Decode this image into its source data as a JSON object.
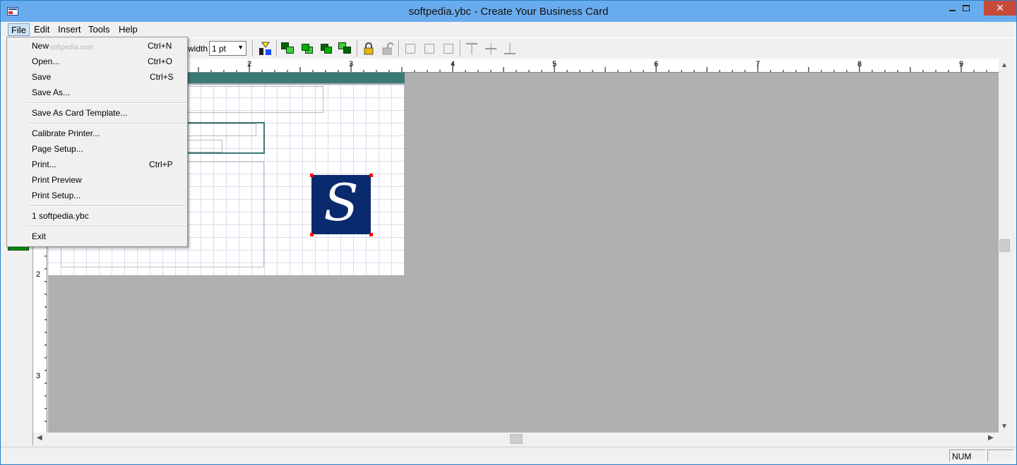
{
  "window": {
    "title": "softpedia.ybc - Create Your Business Card",
    "close_glyph": "✕"
  },
  "menubar": {
    "items": [
      {
        "label": "File"
      },
      {
        "label": "Edit"
      },
      {
        "label": "Insert"
      },
      {
        "label": "Tools"
      },
      {
        "label": "Help"
      }
    ]
  },
  "toolbar": {
    "width_label": "width",
    "width_value": "1 pt",
    "dropdown_glyph": "▼"
  },
  "ruler_top": {
    "numbers": [
      "2",
      "3",
      "4",
      "5",
      "6",
      "7",
      "8",
      "9"
    ]
  },
  "ruler_left": {
    "numbers": [
      "2",
      "3"
    ]
  },
  "logo": {
    "letter": "S",
    "background": "#0a2a6e"
  },
  "file_menu": {
    "watermark": "softpedia.com",
    "items": [
      {
        "label": "New",
        "shortcut": "Ctrl+N"
      },
      {
        "label": "Open...",
        "shortcut": "Ctrl+O"
      },
      {
        "label": "Save",
        "shortcut": "Ctrl+S"
      },
      {
        "label": "Save As...",
        "shortcut": ""
      },
      {
        "label": "Save As Card Template...",
        "shortcut": ""
      },
      {
        "label": "Calibrate Printer...",
        "shortcut": ""
      },
      {
        "label": "Page Setup...",
        "shortcut": ""
      },
      {
        "label": "Print...",
        "shortcut": "Ctrl+P"
      },
      {
        "label": "Print Preview",
        "shortcut": ""
      },
      {
        "label": "Print Setup...",
        "shortcut": ""
      },
      {
        "label": "1 softpedia.ybc",
        "shortcut": ""
      },
      {
        "label": "Exit",
        "shortcut": ""
      }
    ]
  },
  "scroll": {
    "up": "▲",
    "down": "▼",
    "left": "◀",
    "right": "▶"
  },
  "statusbar": {
    "num": "NUM"
  },
  "colors": {
    "titlebar": "#69acee",
    "accent_teal": "#3a7a76",
    "close_red": "#c74a3a"
  }
}
